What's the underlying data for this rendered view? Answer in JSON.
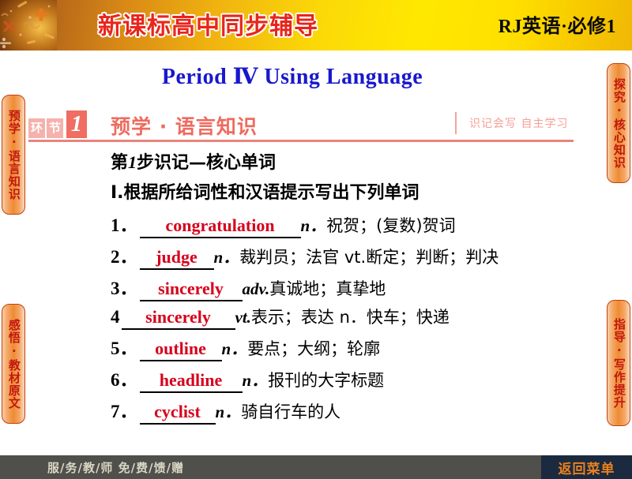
{
  "header": {
    "brand_title": "新课标高中同步辅导",
    "brand_subject": "RJ英语·必修1",
    "texture_icon": "math-symbols-texture"
  },
  "page_title": "Period  Ⅳ  Using Language",
  "section_banner": {
    "badge_char_1": "环",
    "badge_char_2": "节",
    "badge_number": "1",
    "label": "预学 · 语言知识",
    "note": "识记会写  自主学习"
  },
  "content": {
    "step_prefix": "第",
    "step_number": "1",
    "step_suffix": "步识记—核心单词",
    "prompt": "Ⅰ.根据所给词性和汉语提示写出下列单词",
    "words": [
      {
        "index": "1．",
        "answer": "congratulation",
        "pos": "n．",
        "meaning": "祝贺；(复数)贺词"
      },
      {
        "index": "2．",
        "answer": "judge",
        "pos": "n．",
        "meaning": "裁判员；法官 vt.断定；判断；判决"
      },
      {
        "index": "3．",
        "answer": "sincerely",
        "pos": "adv.",
        "meaning": "真诚地；真挚地"
      },
      {
        "index": "4",
        "answer": "sincerely",
        "pos": "vt.",
        "meaning": "表示；表达  n．快车；快递"
      },
      {
        "index": "5．",
        "answer": "outline",
        "pos": "n．",
        "meaning": "要点；大纲；轮廓"
      },
      {
        "index": "6．",
        "answer": "headline",
        "pos": "n．",
        "meaning": "报刊的大字标题"
      },
      {
        "index": "7．",
        "answer": "cyclist",
        "pos": "n．",
        "meaning": "骑自行车的人"
      }
    ]
  },
  "side_tabs": {
    "left": [
      {
        "label": "预学·语言知识"
      },
      {
        "label": "感悟·教材原文"
      }
    ],
    "right": [
      {
        "label": "探究·核心知识"
      },
      {
        "label": "指导·写作提升"
      }
    ]
  },
  "footer": {
    "service_text": "服/务/教/师   免/费/馈/赠",
    "menu_button": "返回菜单"
  },
  "colors": {
    "header_yellow": "#ffe800",
    "header_orange": "#b4651a",
    "brand_red": "#e8251c",
    "title_blue": "#1818cd",
    "banner_salmon": "#ee6b5f",
    "answer_red": "#d6001c",
    "tab_orange": "#ef8b33",
    "tab_text_red": "#c1190e",
    "footer_gray": "#4f4f4b",
    "menu_navy": "#1b2a3f",
    "menu_orange": "#e8811e"
  }
}
